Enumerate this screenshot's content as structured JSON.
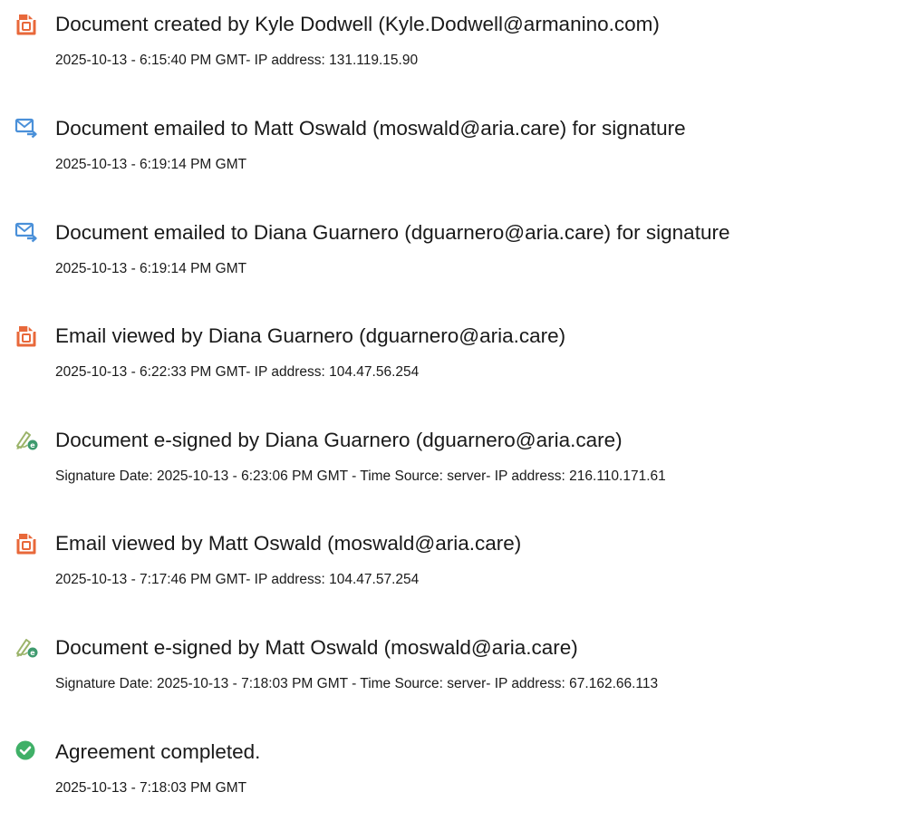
{
  "colors": {
    "doc_icon": "#e8683a",
    "email_icon": "#4a90d9",
    "sign_icon": "#9bb46a",
    "complete_icon": "#3fb067"
  },
  "events": [
    {
      "icon": "document-created-icon",
      "title": "Document created by Kyle Dodwell (Kyle.Dodwell@armanino.com)",
      "detail": "2025-10-13 - 6:15:40 PM GMT- IP address: 131.119.15.90"
    },
    {
      "icon": "email-sent-icon",
      "title": "Document emailed to Matt Oswald (moswald@aria.care) for signature",
      "detail": "2025-10-13 - 6:19:14 PM GMT"
    },
    {
      "icon": "email-sent-icon",
      "title": "Document emailed to Diana Guarnero (dguarnero@aria.care) for signature",
      "detail": "2025-10-13 - 6:19:14 PM GMT"
    },
    {
      "icon": "email-viewed-icon",
      "title": "Email viewed by Diana Guarnero (dguarnero@aria.care)",
      "detail": "2025-10-13 - 6:22:33 PM GMT- IP address: 104.47.56.254"
    },
    {
      "icon": "e-sign-icon",
      "title": "Document e-signed by Diana Guarnero (dguarnero@aria.care)",
      "detail": "Signature Date: 2025-10-13 - 6:23:06 PM GMT - Time Source: server- IP address: 216.110.171.61"
    },
    {
      "icon": "email-viewed-icon",
      "title": "Email viewed by Matt Oswald (moswald@aria.care)",
      "detail": "2025-10-13 - 7:17:46 PM GMT- IP address: 104.47.57.254"
    },
    {
      "icon": "e-sign-icon",
      "title": "Document e-signed by Matt Oswald (moswald@aria.care)",
      "detail": "Signature Date: 2025-10-13 - 7:18:03 PM GMT - Time Source: server- IP address: 67.162.66.113"
    },
    {
      "icon": "check-circle-icon",
      "title": "Agreement completed.",
      "detail": "2025-10-13 - 7:18:03 PM GMT"
    }
  ]
}
